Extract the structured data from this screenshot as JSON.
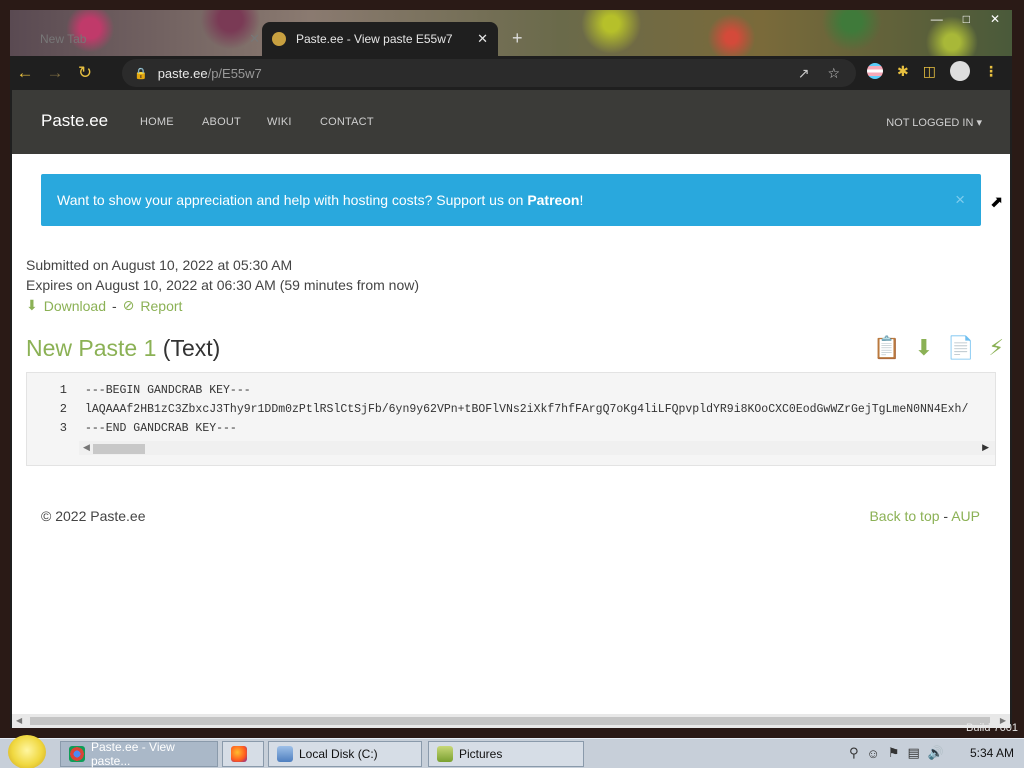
{
  "browser": {
    "inactive_tab": "New Tab",
    "active_tab": "Paste.ee - View paste E55w7",
    "tab_close": "✕",
    "new_tab": "+",
    "url_host": "paste.ee",
    "url_path": "/p/E55w7"
  },
  "site": {
    "brand": "Paste.ee",
    "nav": [
      "HOME",
      "ABOUT",
      "WIKI",
      "CONTACT"
    ],
    "account": "NOT LOGGED IN ▾"
  },
  "alert": {
    "text": "Want to show your appreciation and help with hosting costs? Support us on ",
    "link": "Patreon",
    "suffix": "!",
    "close": "×"
  },
  "paste": {
    "submitted": "Submitted on August 10, 2022 at 05:30 AM",
    "expires": "Expires on August 10, 2022 at 06:30 AM (59 minutes from now)",
    "download": "Download",
    "separator": "-",
    "report": "Report",
    "name": "New Paste 1",
    "type": "(Text)",
    "lines": [
      {
        "n": "1",
        "text": "---BEGIN GANDCRAB KEY---"
      },
      {
        "n": "2",
        "text": "lAQAAAf2HB1zC3ZbxcJ3Thy9r1DDm0zPtlRSlCtSjFb/6yn9y62VPn+tBOFlVNs2iXkf7hfFArgQ7oKg4liLFQpvpldYR9i8KOoCXC0EodGwWZrGejTgLmeN0NN4Exh/"
      },
      {
        "n": "3",
        "text": "---END GANDCRAB KEY---"
      }
    ]
  },
  "footer": {
    "copyright": "© 2022 Paste.ee",
    "back_to_top": "Back to top",
    "dash": "-",
    "aup": "AUP"
  },
  "desktop": {
    "build": "Build 7601",
    "taskbar_items": [
      "Paste.ee - View paste...",
      "",
      "Local Disk (C:)",
      "Pictures"
    ],
    "clock": "5:34 AM"
  },
  "colors": {
    "accent_green": "#8bb155",
    "alert_blue": "#29a8dd",
    "navbar": "#3b3b38"
  }
}
